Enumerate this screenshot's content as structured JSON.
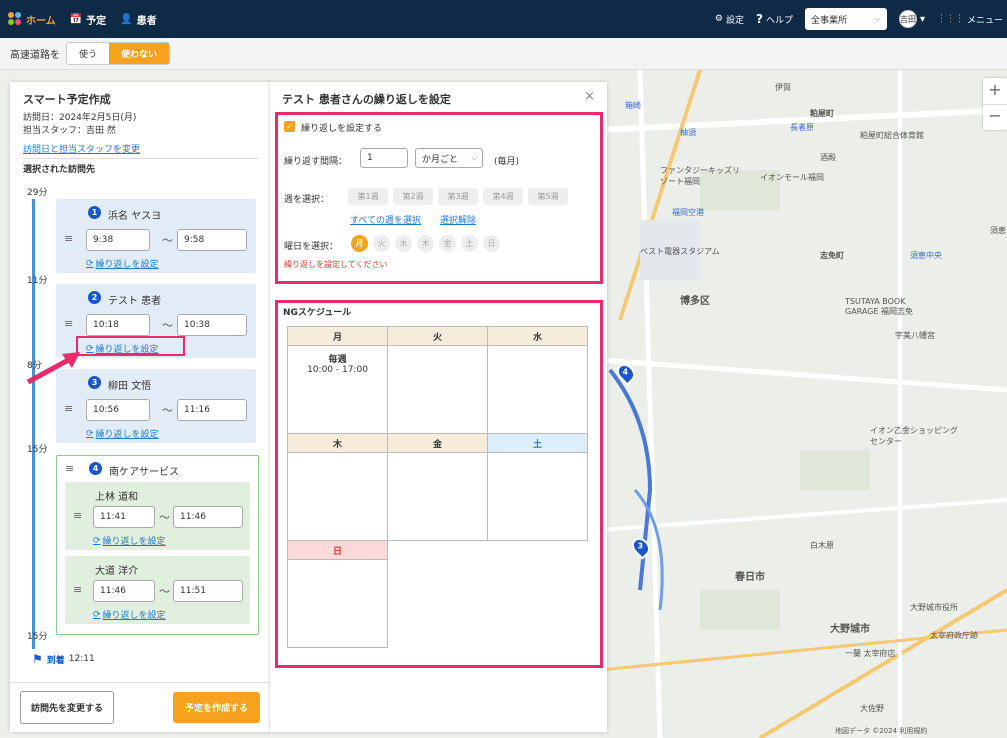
{
  "app": {
    "logo_label": "ホーム",
    "nav": [
      "予定",
      "患者"
    ],
    "settings_label": "設定",
    "help_label": "ヘルプ",
    "office_select": "全事業所",
    "user_name": "吉田",
    "menu_label": "メニュー"
  },
  "highway": {
    "label": "高速道路を",
    "options": [
      "使う",
      "使わない"
    ],
    "selected": "使わない"
  },
  "left_panel": {
    "title": "スマート予定作成",
    "visit_date": "訪問日：2024年2月5日(月)",
    "staff": "担当スタッフ：吉田 然",
    "change_link": "訪問日と担当スタッフを変更",
    "selected_heading": "選択された訪問先",
    "durations": [
      "29分",
      "11分",
      "8分",
      "15分",
      "15分"
    ],
    "visits": [
      {
        "no": "1",
        "name": "浜名 ヤスヨ",
        "start": "9:38",
        "end": "9:58",
        "repeat": "繰り返しを設定"
      },
      {
        "no": "2",
        "name": "テスト 患者",
        "start": "10:18",
        "end": "10:38",
        "repeat": "繰り返しを設定"
      },
      {
        "no": "3",
        "name": "柳田 文悟",
        "start": "10:56",
        "end": "11:16",
        "repeat": "繰り返しを設定"
      }
    ],
    "group": {
      "no": "4",
      "name": "南ケアサービス",
      "members": [
        {
          "name": "上林 道和",
          "start": "11:41",
          "end": "11:46",
          "repeat": "繰り返しを設定"
        },
        {
          "name": "大道 洋介",
          "start": "11:46",
          "end": "11:51",
          "repeat": "繰り返しを設定"
        }
      ]
    },
    "arrival_label": "到着",
    "arrival_time": "12:11",
    "change_btn": "訪問先を変更する",
    "create_btn": "予定を作成する"
  },
  "modal": {
    "title": "テスト 患者さんの繰り返しを設定",
    "close": "×",
    "enable_label": "繰り返しを設定する",
    "interval_label": "繰り返す間隔：",
    "interval_value": "1",
    "interval_unit": "か月ごと",
    "interval_note": "(毎月)",
    "week_label": "週を選択：",
    "weeks": [
      "第1週",
      "第2週",
      "第3週",
      "第4週",
      "第5週"
    ],
    "select_all": "すべての週を選択",
    "clear": "選択解除",
    "dow_label": "曜日を選択：",
    "days": [
      "月",
      "火",
      "水",
      "木",
      "金",
      "土",
      "日"
    ],
    "day_selected": "月",
    "error": "繰り返しを設定してください",
    "ng_title": "NGスケジュール",
    "ng_headers": [
      "月",
      "火",
      "水",
      "木",
      "金",
      "土",
      "日"
    ],
    "ng_mon_label": "毎週",
    "ng_mon_time": "10:00 - 17:00"
  },
  "map_labels": {
    "a": "伊賀",
    "b": "粕屋町",
    "c": "長者原",
    "d": "粕屋町総合体育館",
    "e": "箱崎",
    "f": "柚須",
    "g": "ファンタジーキッズリゾート福岡",
    "h": "イオンモール福岡",
    "i": "酒殿",
    "j": "須恵",
    "k": "ベスト電器スタジアム",
    "l": "志免町",
    "m": "須恵中央",
    "n": "博多区",
    "o": "TSUTAYA BOOK GARAGE 福岡志免",
    "p": "福岡空港",
    "q": "宇美八幡宮",
    "r": "イオン乙金ショッピングセンター",
    "s": "大野城市",
    "t": "春日市",
    "u": "大野城市役所",
    "v": "太宰府政庁跡",
    "w": "白木原",
    "x": "大佐野",
    "y": "一蘭 太宰府店",
    "z": "地図データ ©2024  利用規約"
  },
  "colors": {
    "accent": "#f6a21e",
    "highlight": "#ea2a6a",
    "primary": "#1757c9",
    "nav": "#0e2a47"
  }
}
